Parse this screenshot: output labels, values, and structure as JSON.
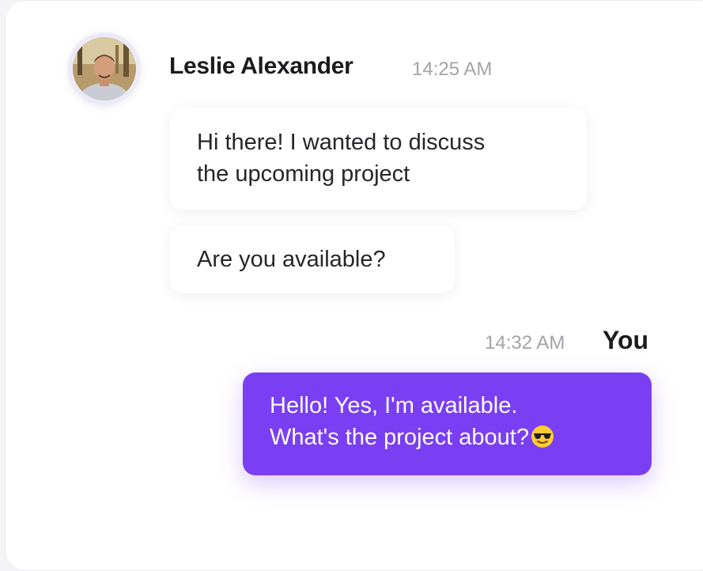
{
  "colors": {
    "accent": "#7a3ff2",
    "bubble_incoming": "#ffffff",
    "timestamp": "#a3a3ab",
    "name_text": "#1b1b1f"
  },
  "incoming": {
    "sender_name": "Leslie Alexander",
    "timestamp": "14:25 AM",
    "avatar_icon": "user-photo",
    "messages": [
      {
        "lines": [
          "Hi there! I wanted to discuss",
          "the upcoming project"
        ]
      },
      {
        "lines": [
          "Are you available?"
        ]
      }
    ]
  },
  "outgoing": {
    "sender_name": "You",
    "timestamp": "14:32 AM",
    "messages": [
      {
        "lines": [
          "Hello! Yes, I'm available.",
          "What's the project about?"
        ],
        "emoji_icon": "sunglasses-emoji-icon"
      }
    ]
  }
}
